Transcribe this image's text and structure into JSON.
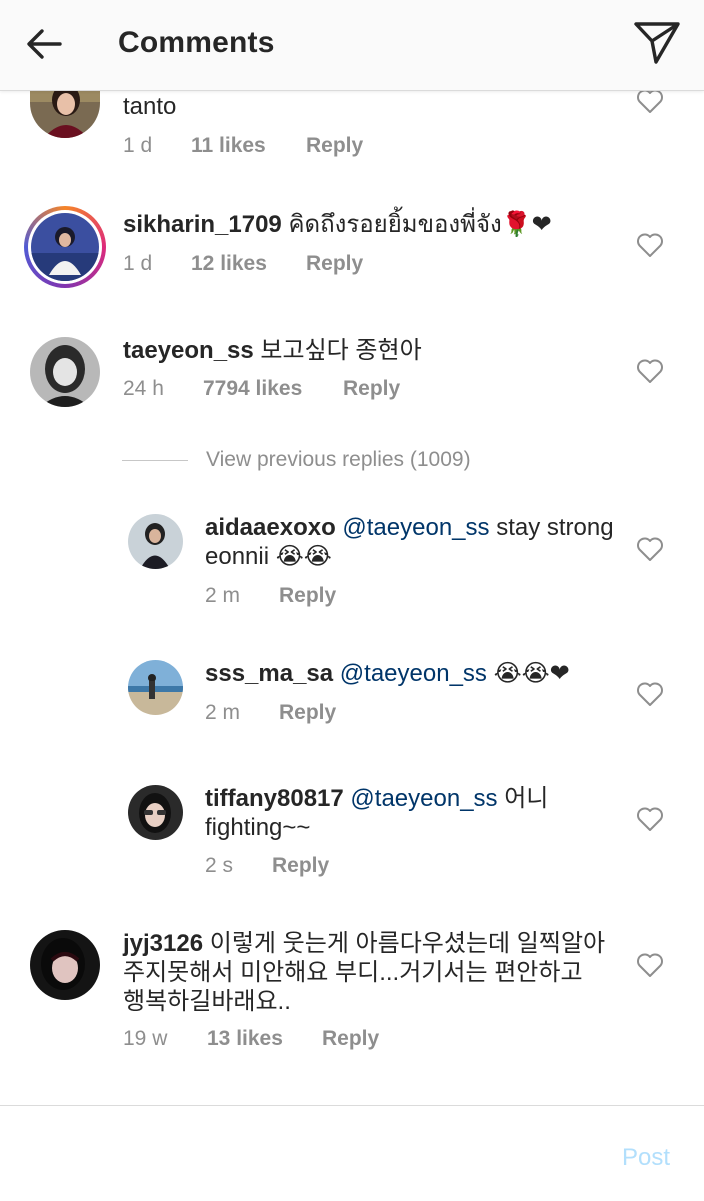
{
  "header": {
    "title": "Comments",
    "back_icon": "arrow-left-icon",
    "share_icon": "paper-plane-icon"
  },
  "comments": [
    {
      "text": "tanto",
      "time": "1 d",
      "likes": "11 likes",
      "reply": "Reply"
    },
    {
      "username": "sikharin_1709",
      "text": " คิดถึงรอยยิ้มของพี่จัง🌹❤",
      "time": "1 d",
      "likes": "12 likes",
      "reply": "Reply"
    },
    {
      "username": "taeyeon_ss",
      "text": " 보고싶다 종현아",
      "time": "24 h",
      "likes": "7794 likes",
      "reply": "Reply"
    }
  ],
  "view_previous": "View previous replies (1009)",
  "replies": [
    {
      "username": "aidaaexoxo",
      "mention": " @taeyeon_ss",
      "text": " stay strong eonnii 😭😭",
      "time": "2 m",
      "reply": "Reply"
    },
    {
      "username": "sss_ma_sa",
      "mention": " @taeyeon_ss",
      "text": " 😭😭❤",
      "time": "2 m",
      "reply": "Reply"
    },
    {
      "username": "tiffany80817",
      "mention": " @taeyeon_ss",
      "text": " 어니 fighting~~",
      "time": "2 s",
      "reply": "Reply"
    }
  ],
  "last_comment": {
    "username": "jyj3126",
    "text": " 이렇게 웃는게 아름다우셨는데 일찍알아 주지못해서 미안해요 부디...거기서는 편안하고 행복하길바래요..",
    "time": "19 w",
    "likes": "13 likes",
    "reply": "Reply"
  },
  "composer": {
    "post_label": "Post"
  },
  "colors": {
    "mention": "#003569",
    "meta": "#8e8e8e",
    "post_disabled": "#b2dffc"
  }
}
